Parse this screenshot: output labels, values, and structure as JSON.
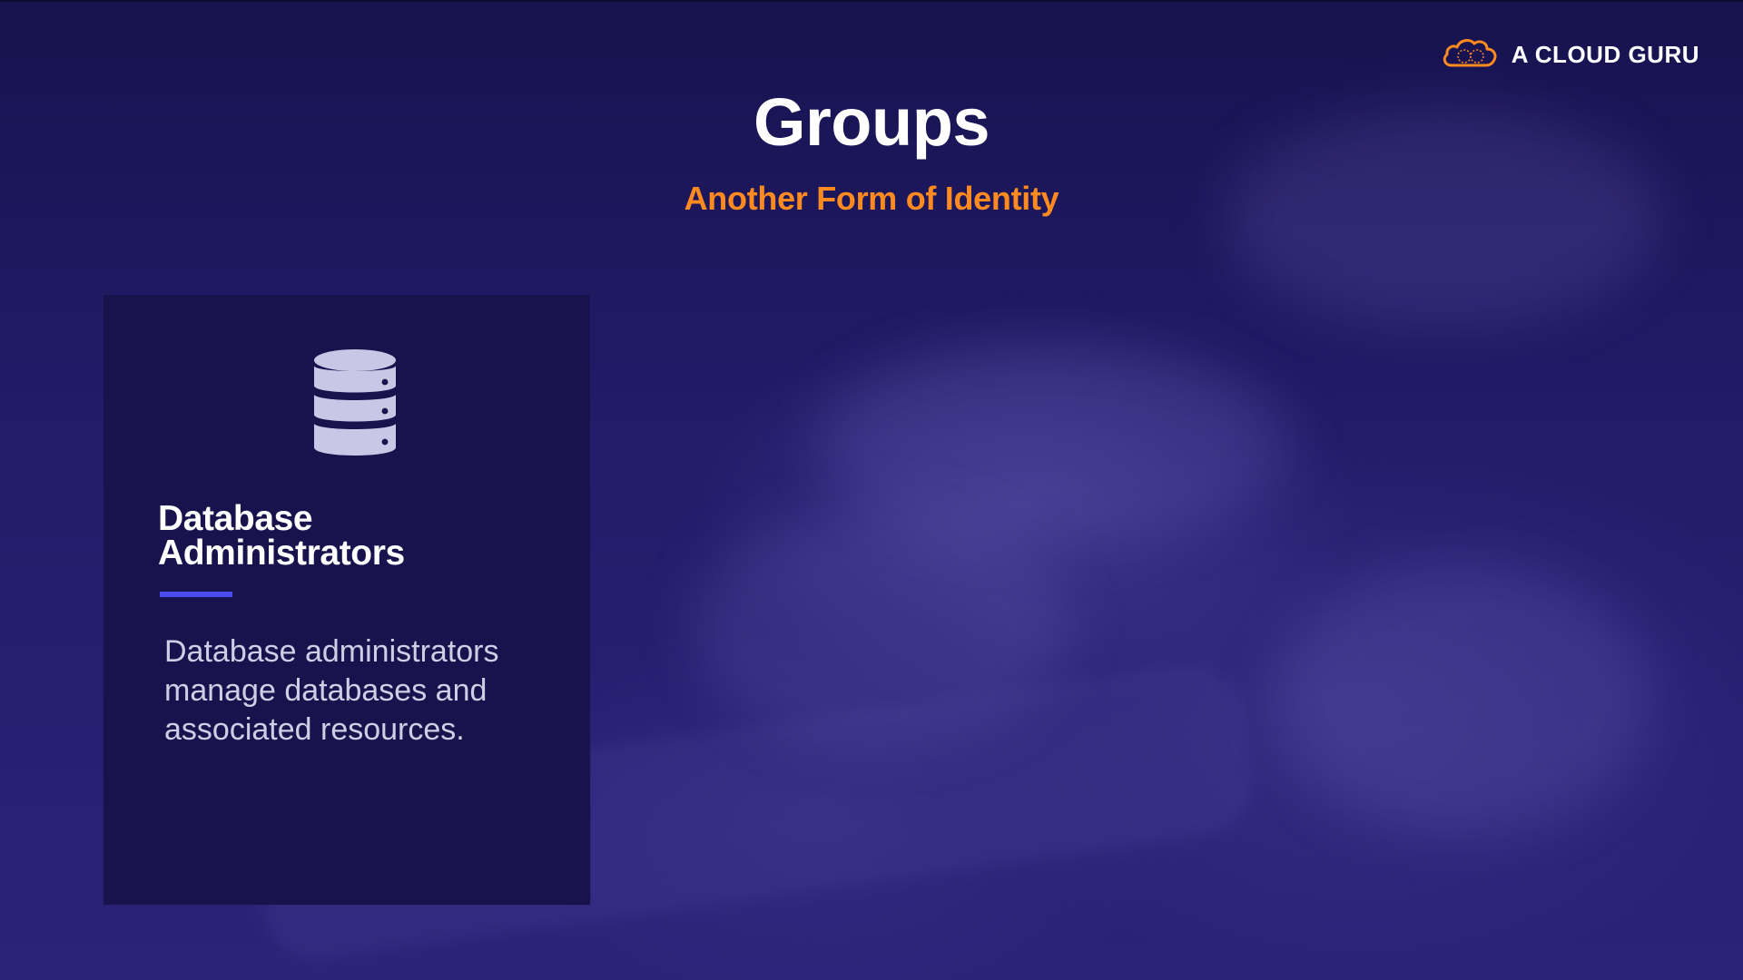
{
  "brand": {
    "logo_text": "A CLOUD GURU",
    "accent_orange": "#ff8a1f"
  },
  "slide": {
    "title": "Groups",
    "subtitle": "Another Form of Identity"
  },
  "card": {
    "icon": "database-icon",
    "title_line1": "Database",
    "title_line2": "Administrators",
    "description": "Database administrators manage databases and associated resources.",
    "accent_color": "#4a4bf0"
  }
}
